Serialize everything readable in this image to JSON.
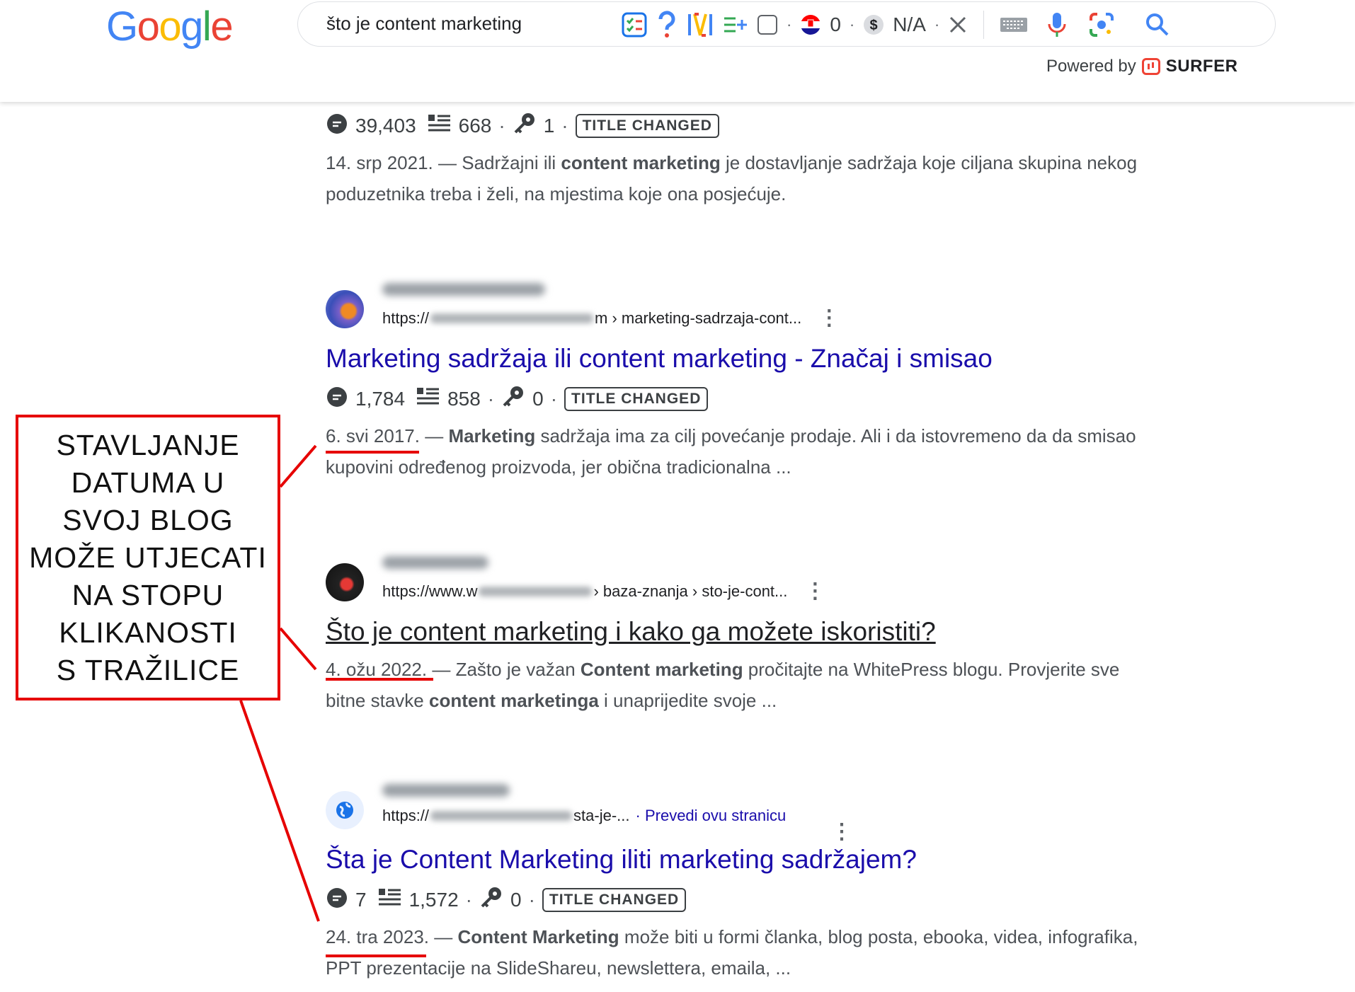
{
  "header": {
    "logo": "Google",
    "query": "što je content marketing",
    "counter_flag_value": "0",
    "cost_value": "N/A",
    "powered_by": "Powered by",
    "surfer": "SURFER"
  },
  "results": [
    {
      "metrics": {
        "searches": "39,403",
        "words": "668",
        "keywords": "1"
      },
      "badge": "TITLE CHANGED",
      "date": "14. srp 2021.",
      "snippet": [
        {
          "text": " — Sadržajni ili ",
          "bold": false
        },
        {
          "text": "content marketing",
          "bold": true
        },
        {
          "text": " je dostavljanje sadržaja koje ciljana skupina nekog poduzetnika treba i želi, na mjestima koje ona posjećuje.",
          "bold": false
        }
      ]
    },
    {
      "url_start": "https://",
      "url_tail": "m › marketing-sadrzaja-cont...",
      "title": "Marketing sadržaja ili content marketing - Značaj i smisao",
      "metrics": {
        "searches": "1,784",
        "words": "858",
        "keywords": "0"
      },
      "badge": "TITLE CHANGED",
      "date": "6. svi 2017.",
      "snippet": [
        {
          "text": " — ",
          "bold": false
        },
        {
          "text": "Marketing",
          "bold": true
        },
        {
          "text": " sadržaja ima za cilj povećanje prodaje. Ali i da istovremeno da da smisao kupovini određenog proizvoda, jer obična tradicionalna ...",
          "bold": false
        }
      ]
    },
    {
      "url_start": "https://www.w",
      "url_tail": "› baza-znanja › sto-je-cont...",
      "title": "Što je content marketing i kako ga možete iskoristiti?",
      "date": "4. ožu 2022.",
      "snippet": [
        {
          "text": " — Zašto je važan ",
          "bold": false
        },
        {
          "text": "Content marketing",
          "bold": true
        },
        {
          "text": " pročitajte na WhitePress blogu. Provjerite sve bitne stavke ",
          "bold": false
        },
        {
          "text": "content marketinga",
          "bold": true
        },
        {
          "text": " i unaprijedite svoje ...",
          "bold": false
        }
      ]
    },
    {
      "url_start": "https://",
      "url_tail": "sta-je-...",
      "translate": "· Prevedi ovu stranicu",
      "title": "Šta je Content Marketing iliti marketing sadržajem?",
      "metrics": {
        "searches": "7",
        "words": "1,572",
        "keywords": "0"
      },
      "badge": "TITLE CHANGED",
      "date": "24. tra 2023.",
      "snippet": [
        {
          "text": " — ",
          "bold": false
        },
        {
          "text": "Content Marketing",
          "bold": true
        },
        {
          "text": " može biti u formi članka, blog posta, ebooka, videa, infografika, PPT prezentacije na SlideShareu, newslettera, emaila, ...",
          "bold": false
        }
      ]
    }
  ],
  "callout": {
    "lines": [
      "STAVLJANJE",
      "DATUMA U",
      "SVOJ BLOG",
      "MOŽE UTJECATI",
      "NA STOPU",
      "KLIKANOSTI",
      "S TRAŽILICE"
    ]
  },
  "colors": {
    "link": "#1a0dab",
    "annotation": "#e60000"
  }
}
